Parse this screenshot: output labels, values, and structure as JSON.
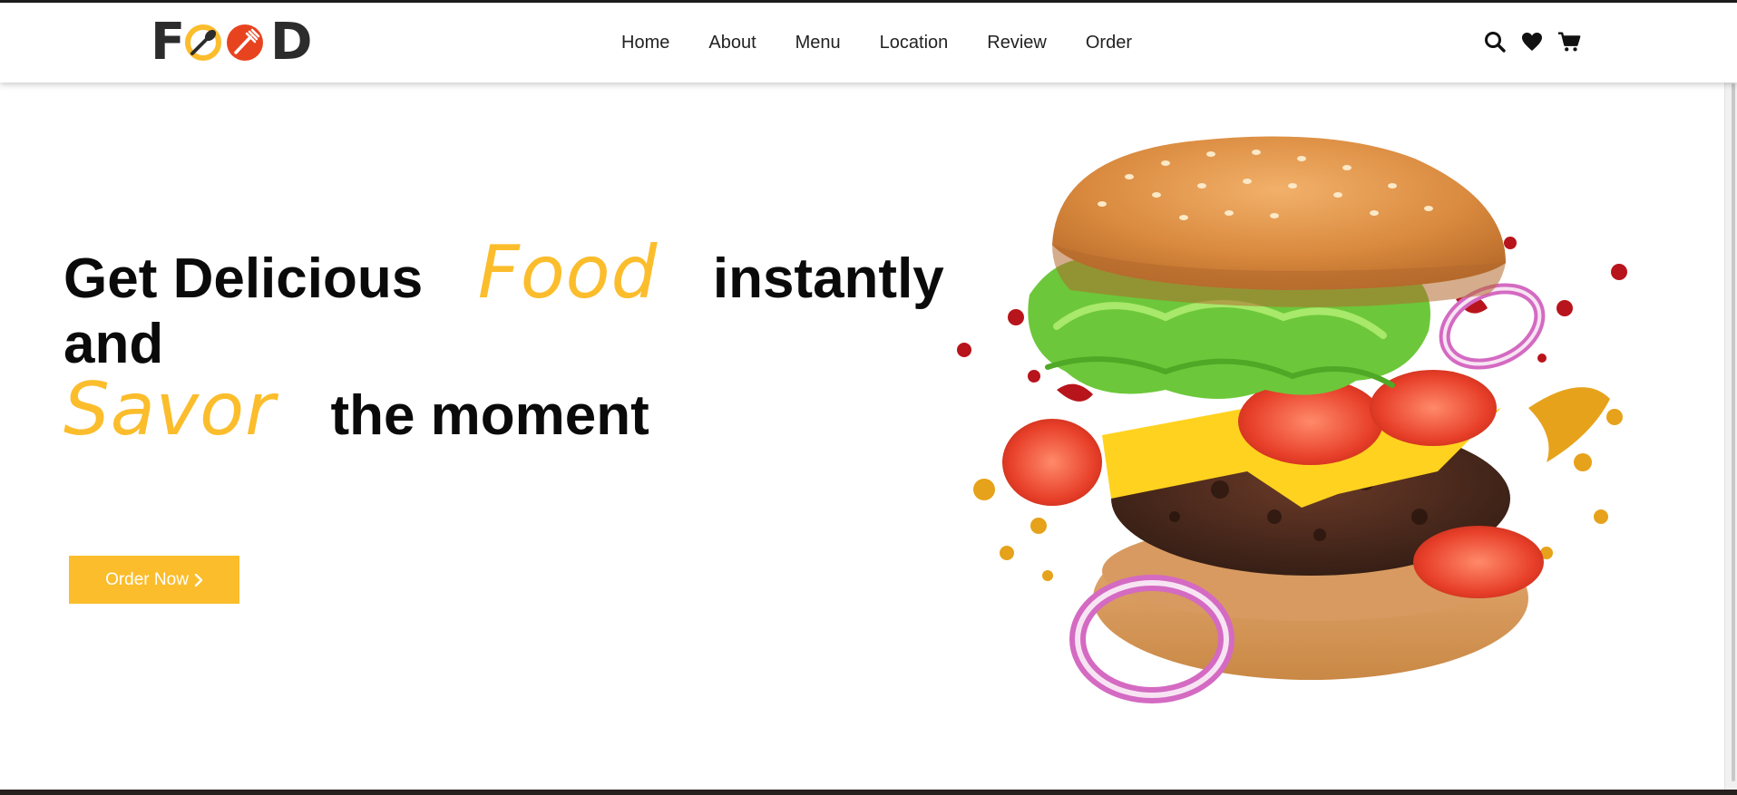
{
  "header": {
    "logo": {
      "text": "FOOD",
      "letter_f": "F",
      "letter_d": "D",
      "colors": {
        "dark": "#2c2c2c",
        "yellow": "#fbbd2c",
        "red": "#e8431f"
      }
    },
    "nav": [
      {
        "label": "Home"
      },
      {
        "label": "About"
      },
      {
        "label": "Menu"
      },
      {
        "label": "Location"
      },
      {
        "label": "Review"
      },
      {
        "label": "Order"
      }
    ],
    "icons": [
      "search-icon",
      "heart-icon",
      "cart-icon"
    ]
  },
  "hero": {
    "headline_1": "Get Delicious",
    "highlight_1": "Food",
    "headline_2": "instantly",
    "headline_3": "and",
    "highlight_2": "Savor",
    "headline_4": "the moment",
    "button_label": "Order Now",
    "button_icon": "chevron-right-icon",
    "image": "burger-image"
  },
  "colors": {
    "accent": "#fbbd2c",
    "text": "#0a0a0a",
    "nav_text": "#222222",
    "background": "#ffffff"
  }
}
